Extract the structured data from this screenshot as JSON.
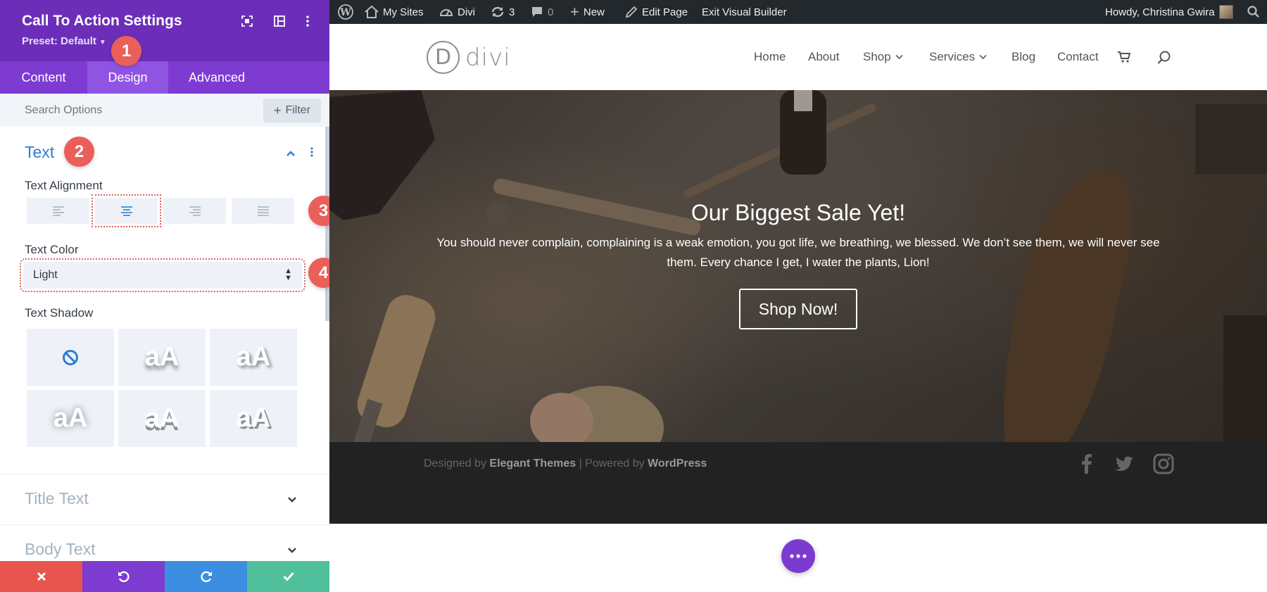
{
  "panel": {
    "title": "Call To Action Settings",
    "preset": "Preset: Default",
    "tabs": [
      {
        "label": "Content"
      },
      {
        "label": "Design"
      },
      {
        "label": "Advanced"
      }
    ],
    "search_placeholder": "Search Options",
    "filter_label": "Filter",
    "text_section": {
      "title": "Text",
      "alignment_label": "Text Alignment",
      "alignment_selected": "center",
      "color_label": "Text Color",
      "color_value": "Light",
      "shadow_label": "Text Shadow",
      "shadow_sample": "aA"
    },
    "collapsed_sections": [
      {
        "title": "Title Text"
      },
      {
        "title": "Body Text"
      }
    ],
    "badges": [
      "1",
      "2",
      "3",
      "4"
    ]
  },
  "adminbar": {
    "my_sites": "My Sites",
    "site_name": "Divi",
    "updates": "3",
    "comments": "0",
    "new": "New",
    "edit_page": "Edit Page",
    "exit_builder": "Exit Visual Builder",
    "howdy": "Howdy, Christina Gwira"
  },
  "site": {
    "logo_letter": "D",
    "logo_text": "divi",
    "nav": {
      "home": "Home",
      "about": "About",
      "shop": "Shop",
      "services": "Services",
      "blog": "Blog",
      "contact": "Contact"
    }
  },
  "hero": {
    "title": "Our Biggest Sale Yet!",
    "body": "You should never complain, complaining is a weak emotion, you got life, we breathing, we blessed. We don’t see them, we will never see them. Every chance I get, I water the plants, Lion!",
    "button": "Shop Now!"
  },
  "footer": {
    "designed_by": "Designed by",
    "elegant": "Elegant Themes",
    "powered_by": "| Powered by",
    "wordpress": "WordPress"
  },
  "colors": {
    "panel_header": "#6c2eb9",
    "tabs_bg": "#7d3bd1",
    "active_tab": "#9054e3",
    "accent_blue": "#2e7ed1",
    "badge": "#ea5f5a",
    "cancel": "#e8554e",
    "undo": "#7e3bd0",
    "redo": "#3c8ee0",
    "save": "#4fc09b"
  }
}
